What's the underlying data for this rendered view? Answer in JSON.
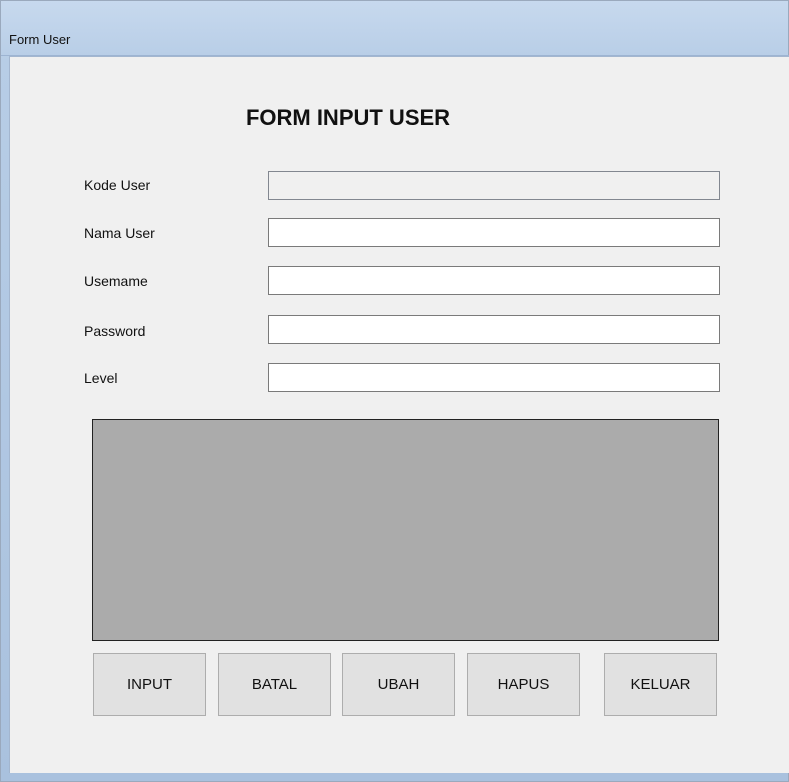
{
  "window": {
    "title": "Form User"
  },
  "form": {
    "heading": "FORM INPUT USER",
    "fields": [
      {
        "label": "Kode User",
        "value": ""
      },
      {
        "label": "Nama User",
        "value": ""
      },
      {
        "label": "Usemame",
        "value": ""
      },
      {
        "label": "Password",
        "value": ""
      },
      {
        "label": "Level",
        "value": ""
      }
    ]
  },
  "buttons": {
    "input": "INPUT",
    "batal": "BATAL",
    "ubah": "UBAH",
    "hapus": "HAPUS",
    "keluar": "KELUAR"
  },
  "colors": {
    "client_background": "#f0f0f0",
    "grid_background": "#ababab",
    "button_background": "#e1e1e1"
  }
}
